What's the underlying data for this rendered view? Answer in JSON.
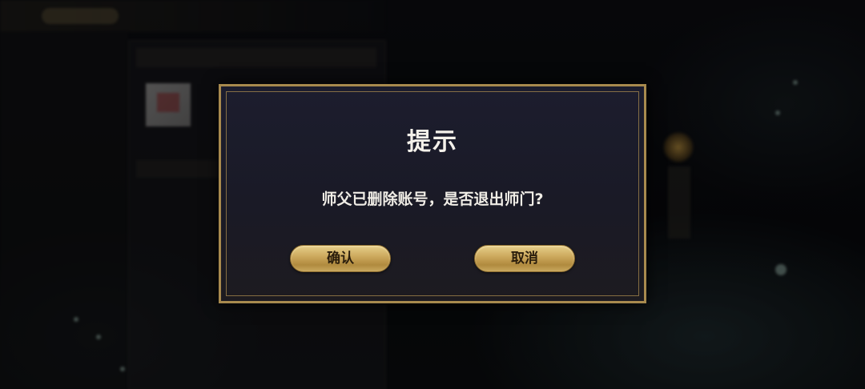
{
  "dialog": {
    "title": "提示",
    "message": "师父已删除账号，是否退出师门?",
    "confirm_label": "确认",
    "cancel_label": "取消"
  },
  "colors": {
    "dialog_border": "#a88a4e",
    "dialog_background": "#1c1d2e",
    "button_gold": "#caa65a",
    "button_text": "#2a1d0c",
    "text": "#f4f1ea"
  }
}
